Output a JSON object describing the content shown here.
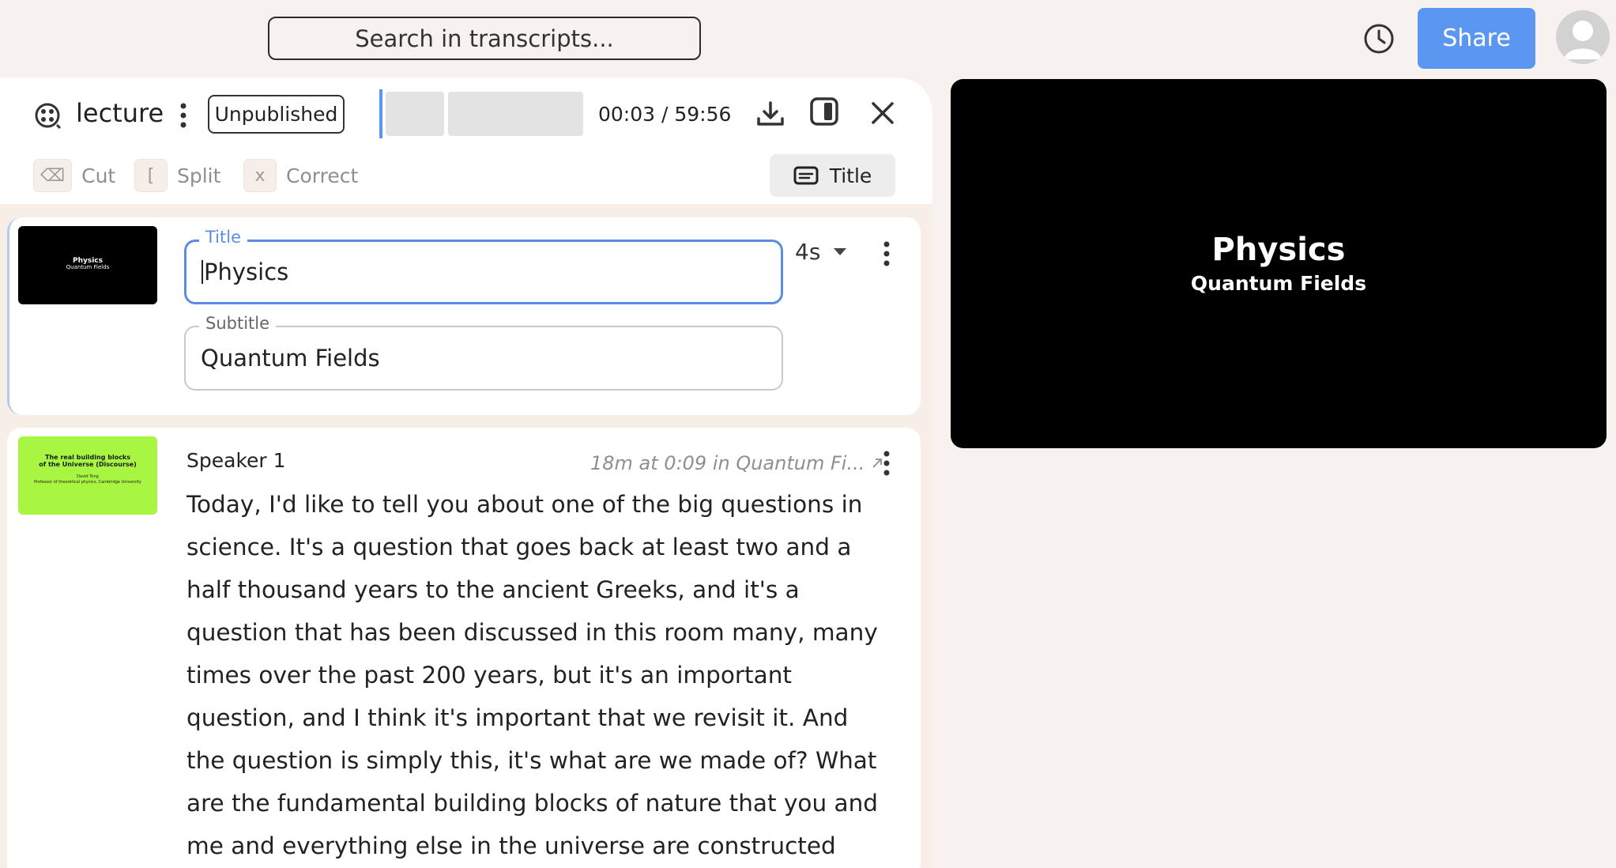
{
  "header": {
    "search_placeholder": "Search in transcripts...",
    "share_label": "Share"
  },
  "editor": {
    "doc_name": "lecture",
    "status": "Unpublished",
    "time_readout": "00:03 / 59:56",
    "tools": [
      {
        "key": "⌫",
        "label": "Cut"
      },
      {
        "key": "[",
        "label": "Split"
      },
      {
        "key": "x",
        "label": "Correct"
      }
    ],
    "title_button_label": "Title"
  },
  "title_card": {
    "thumb_title": "Physics",
    "thumb_subtitle": "Quantum Fields",
    "title_label": "Title",
    "title_value": "Physics",
    "subtitle_label": "Subtitle",
    "subtitle_value": "Quantum Fields",
    "duration": "4s"
  },
  "speech_card": {
    "thumb_line1": "The real building blocks",
    "thumb_line2": "of the Universe (Discourse)",
    "thumb_author": "David Tong",
    "thumb_affiliation": "Professor of theoretical physics, Cambridge University",
    "speaker": "Speaker 1",
    "source": "18m at 0:09 in Quantum Fi...",
    "text": "Today, I'd like to tell you about one of the big questions in science. It's a question that goes back at least two and a half thousand years to the ancient Greeks, and it's a question that has been discussed in this room many, many times over the past 200 years, but it's an important question, and I think it's important that we revisit it. And the question is simply this, it's what are we made of? What are the fundamental building blocks of nature that you and me and everything else in the universe are constructed for?"
  },
  "preview": {
    "title": "Physics",
    "subtitle": "Quantum Fields"
  },
  "colors": {
    "accent": "#5b96f0",
    "background": "#f7f2ef",
    "thumb_green": "#a8f542"
  }
}
